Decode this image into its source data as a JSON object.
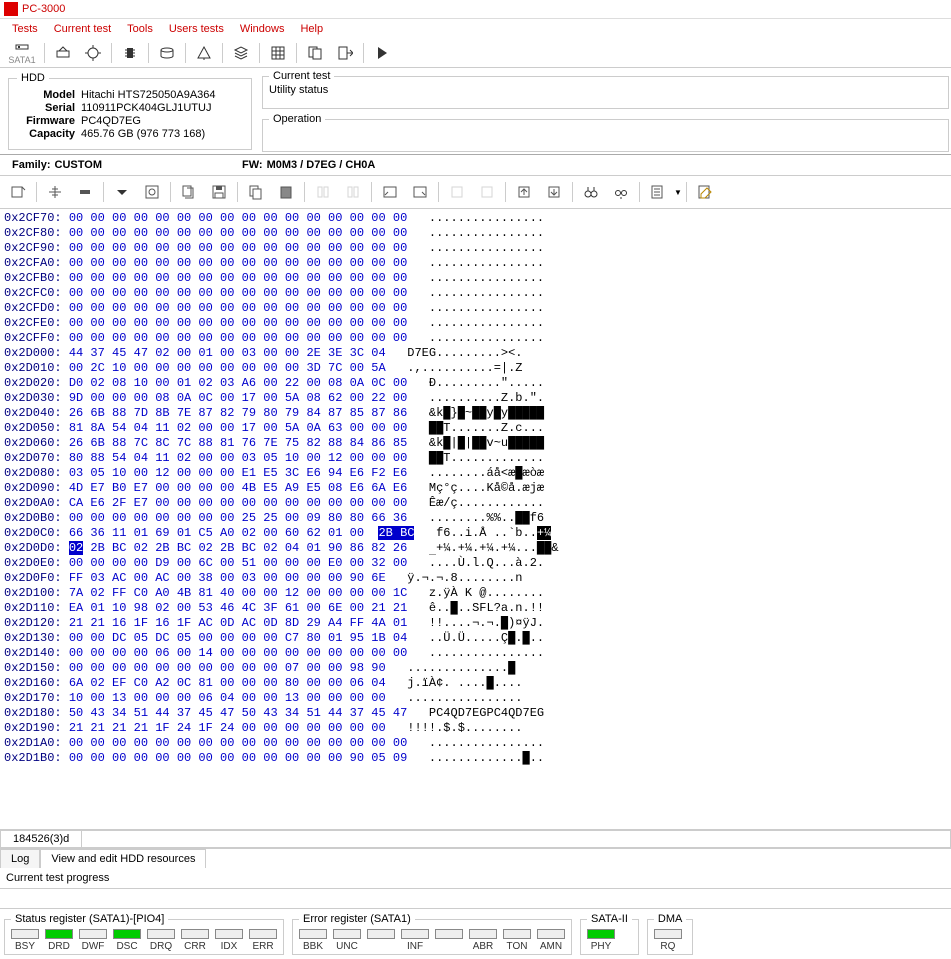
{
  "app": {
    "title": "PC-3000"
  },
  "menu": [
    "Tests",
    "Current test",
    "Tools",
    "Users tests",
    "Windows",
    "Help"
  ],
  "sata": "SATA1",
  "hdd": {
    "legend": "HDD",
    "model_label": "Model",
    "model": "Hitachi HTS725050A9A364",
    "serial_label": "Serial",
    "serial": "110911PCK404GLJ1UTUJ",
    "firmware_label": "Firmware",
    "firmware": "PC4QD7EG",
    "capacity_label": "Capacity",
    "capacity": "465.76 GB (976 773 168)"
  },
  "panels": {
    "current_test": "Current test",
    "utility_status": "Utility status",
    "operation": "Operation"
  },
  "family": {
    "label": "Family:",
    "value": "CUSTOM",
    "fw_label": "FW:",
    "fw_value": "M0M3 / D7EG / CH0A"
  },
  "hex": {
    "lines": [
      {
        "a": "0x2CF70:",
        "h": "00 00 00 00 00 00 00 00 00 00 00 00 00 00 00 00",
        "t": "................"
      },
      {
        "a": "0x2CF80:",
        "h": "00 00 00 00 00 00 00 00 00 00 00 00 00 00 00 00",
        "t": "................"
      },
      {
        "a": "0x2CF90:",
        "h": "00 00 00 00 00 00 00 00 00 00 00 00 00 00 00 00",
        "t": "................"
      },
      {
        "a": "0x2CFA0:",
        "h": "00 00 00 00 00 00 00 00 00 00 00 00 00 00 00 00",
        "t": "................"
      },
      {
        "a": "0x2CFB0:",
        "h": "00 00 00 00 00 00 00 00 00 00 00 00 00 00 00 00",
        "t": "................"
      },
      {
        "a": "0x2CFC0:",
        "h": "00 00 00 00 00 00 00 00 00 00 00 00 00 00 00 00",
        "t": "................"
      },
      {
        "a": "0x2CFD0:",
        "h": "00 00 00 00 00 00 00 00 00 00 00 00 00 00 00 00",
        "t": "................"
      },
      {
        "a": "0x2CFE0:",
        "h": "00 00 00 00 00 00 00 00 00 00 00 00 00 00 00 00",
        "t": "................"
      },
      {
        "a": "0x2CFF0:",
        "h": "00 00 00 00 00 00 00 00 00 00 00 00 00 00 00 00",
        "t": "................"
      },
      {
        "a": "0x2D000:",
        "h": "44 37 45 47 02 00 01 00 03 00 00 2E 3E 3C 04",
        "t": "D7EG.........><."
      },
      {
        "a": "0x2D010:",
        "h": "00 2C 10 00 00 00 00 00 00 00 00 3D 7C 00 5A",
        "t": ".,..........=|.Z"
      },
      {
        "a": "0x2D020:",
        "h": "D0 02 08 10 00 01 02 03 A6 00 22 00 08 0A 0C 00",
        "t": "Ð.........\"....."
      },
      {
        "a": "0x2D030:",
        "h": "9D 00 00 00 08 0A 0C 00 17 00 5A 08 62 00 22 00",
        "t": "..........Z.b.\"."
      },
      {
        "a": "0x2D040:",
        "h": "26 6B 88 7D 8B 7E 87 82 79 80 79 84 87 85 87 86",
        "t": "&k█}█~██y█y█████"
      },
      {
        "a": "0x2D050:",
        "h": "81 8A 54 04 11 02 00 00 17 00 5A 0A 63 00 00 00",
        "t": "██T.......Z.c..."
      },
      {
        "a": "0x2D060:",
        "h": "26 6B 88 7C 8C 7C 88 81 76 7E 75 82 88 84 86 85",
        "t": "&k█|█|██v~u█████"
      },
      {
        "a": "0x2D070:",
        "h": "80 88 54 04 11 02 00 00 03 05 10 00 12 00 00 00",
        "t": "██T............."
      },
      {
        "a": "0x2D080:",
        "h": "03 05 10 00 12 00 00 00 E1 E5 3C E6 94 E6 F2 E6",
        "t": "........áå<æ█æòæ"
      },
      {
        "a": "0x2D090:",
        "h": "4D E7 B0 E7 00 00 00 00 4B E5 A9 E5 08 E6 6A E6",
        "t": "Mç°ç....Kå©å.æjæ"
      },
      {
        "a": "0x2D0A0:",
        "h": "CA E6 2F E7 00 00 00 00 00 00 00 00 00 00 00 00",
        "t": "Êæ/ç............"
      },
      {
        "a": "0x2D0B0:",
        "h": "00 00 00 00 00 00 00 00 25 25 00 09 80 80 66 36",
        "t": "........%%..██f6"
      },
      {
        "a": "0x2D0C0:",
        "h": "66 36 11 01 69 01 C5 A0 02 00 60 62 01 00 ",
        "hl": "2B BC",
        "t": "f6..i.Å ..`b..",
        "thl": "+¼"
      },
      {
        "a": "0x2D0D0:",
        "sel": "02",
        "h2": " 2B BC 02 2B BC 02 2B BC 02 04 01 90 86 82 26",
        "t": "█",
        "t2": "+¼.+¼.+¼.+¼...██&"
      },
      {
        "a": "0x2D0E0:",
        "h": "00 00 00 00 D9 00 6C 00 51 00 00 00 E0 00 32 00",
        "t": "....Ù.l.Q...à.2."
      },
      {
        "a": "0x2D0F0:",
        "h": "FF 03 AC 00 AC 00 38 00 03 00 00 00 00 90 6E",
        "t": "ÿ.¬.¬.8........n"
      },
      {
        "a": "0x2D100:",
        "h": "7A 02 FF C0 A0 4B 81 40 00 00 12 00 00 00 00 1C",
        "t": "z.ÿÀ K @........"
      },
      {
        "a": "0x2D110:",
        "h": "EA 01 10 98 02 00 53 46 4C 3F 61 00 6E 00 21 21",
        "t": "ê..█..SFL?a.n.!!"
      },
      {
        "a": "0x2D120:",
        "h": "21 21 16 1F 16 1F AC 0D AC 0D 8D 29 A4 FF 4A 01",
        "t": "!!....¬.¬.█)¤ÿJ."
      },
      {
        "a": "0x2D130:",
        "h": "00 00 DC 05 DC 05 00 00 00 00 C7 80 01 95 1B 04",
        "t": "..Ü.Ü.....Ç█.█.."
      },
      {
        "a": "0x2D140:",
        "h": "00 00 00 00 06 00 14 00 00 00 00 00 00 00 00 00",
        "t": "................"
      },
      {
        "a": "0x2D150:",
        "h": "00 00 00 00 00 00 00 00 00 00 07 00 00 98 90",
        "t": "..............█"
      },
      {
        "a": "0x2D160:",
        "h": "6A 02 EF C0 A2 0C 81 00 00 00 80 00 00 06 04",
        "t": "j.ïÀ¢. ....█...."
      },
      {
        "a": "0x2D170:",
        "h": "10 00 13 00 00 00 06 04 00 00 13 00 00 00 00",
        "t": "................"
      },
      {
        "a": "0x2D180:",
        "h": "50 43 34 51 44 37 45 47 50 43 34 51 44 37 45 47",
        "t": "PC4QD7EGPC4QD7EG"
      },
      {
        "a": "0x2D190:",
        "h": "21 21 21 21 1F 24 1F 24 00 00 00 00 00 00 00",
        "t": "!!!!.$.$........"
      },
      {
        "a": "0x2D1A0:",
        "h": "00 00 00 00 00 00 00 00 00 00 00 00 00 00 00 00",
        "t": "................"
      },
      {
        "a": "0x2D1B0:",
        "h": "00 00 00 00 00 00 00 00 00 00 00 00 00 90 05 09",
        "t": ".............█.."
      }
    ]
  },
  "bottom_tab": "184526(3)d",
  "tabs2": [
    "Log",
    "View and edit HDD resources"
  ],
  "progress": "Current test progress",
  "status": {
    "sr_legend": "Status register (SATA1)-[PIO4]",
    "sr": [
      {
        "l": "BSY",
        "on": false
      },
      {
        "l": "DRD",
        "on": true
      },
      {
        "l": "DWF",
        "on": false
      },
      {
        "l": "DSC",
        "on": true
      },
      {
        "l": "DRQ",
        "on": false
      },
      {
        "l": "CRR",
        "on": false
      },
      {
        "l": "IDX",
        "on": false
      },
      {
        "l": "ERR",
        "on": false
      }
    ],
    "er_legend": "Error register (SATA1)",
    "er": [
      {
        "l": "BBK"
      },
      {
        "l": "UNC"
      },
      {
        "l": ""
      },
      {
        "l": "INF"
      },
      {
        "l": ""
      },
      {
        "l": "ABR"
      },
      {
        "l": "TON"
      },
      {
        "l": "AMN"
      }
    ],
    "sata_legend": "SATA-II",
    "sata": [
      {
        "l": "PHY",
        "on": true
      }
    ],
    "dma_legend": "DMA",
    "dma": [
      {
        "l": "RQ",
        "on": false
      }
    ]
  }
}
